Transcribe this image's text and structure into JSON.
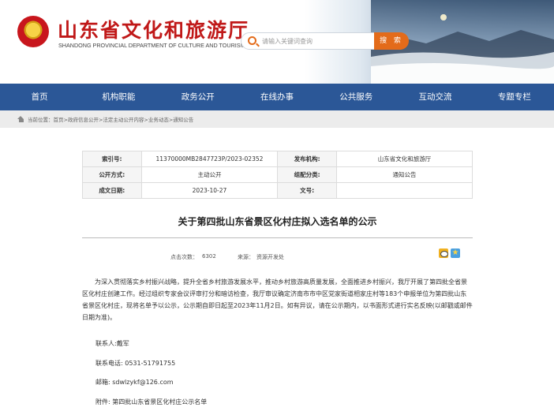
{
  "header": {
    "site_title": "山东省文化和旅游厅",
    "site_subtitle": "SHANDONG PROVINCIAL DEPARTMENT OF CULTURE AND TOURISM"
  },
  "search": {
    "placeholder": "请输入关键词查询",
    "button_label": "搜 索"
  },
  "nav": {
    "items": [
      "首页",
      "机构职能",
      "政务公开",
      "在线办事",
      "公共服务",
      "互动交流",
      "专题专栏"
    ]
  },
  "breadcrumb": {
    "text": "当前位置：首页>政府信息公开>法定主动公开内容>业务动态>通知公告"
  },
  "info": {
    "index_label": "索引号:",
    "index_value": "11370000MB2847723P/2023-02352",
    "publisher_label": "发布机构:",
    "publisher_value": "山东省文化和旅游厅",
    "disclosure_label": "公开方式:",
    "disclosure_value": "主动公开",
    "category_label": "组配分类:",
    "category_value": "通知公告",
    "date_label": "成文日期:",
    "date_value": "2023-10-27",
    "docno_label": "文号:",
    "docno_value": ""
  },
  "article": {
    "title": "关于第四批山东省景区化村庄拟入选名单的公示",
    "views_label": "点击次数：",
    "views": "6302",
    "source_label": "来源：",
    "source": "资源开发处",
    "body": "为深入贯彻落实乡村振兴战略，提升全省乡村旅游发展水平，推动乡村旅游高质量发展，全面推进乡村振兴，我厅开展了第四批全省景区化村庄创建工作。经过组织专家会议评审打分和暗访检查，我厅审议确定济南市市中区党家街道相家庄村等183个申报单位为第四批山东省景区化村庄，现将名单予以公示，公示期自即日起至2023年11月2日。如有异议，请在公示期内，以书面形式进行实名反映(以邮戳或邮件日期为准)。",
    "contact_person": "联系人:戴军",
    "contact_phone": "联系电话: 0531-51791755",
    "email": "邮箱: sdwlzykf@126.com",
    "attachment": "附件: 第四批山东省景区化村庄公示名单"
  },
  "colors": {
    "nav_bg": "#2b5797",
    "title_red": "#c01818",
    "search_orange": "#e36b1a"
  },
  "icons": [
    "emblem-icon",
    "search-icon",
    "home-icon",
    "wechat-icon",
    "star-icon"
  ]
}
